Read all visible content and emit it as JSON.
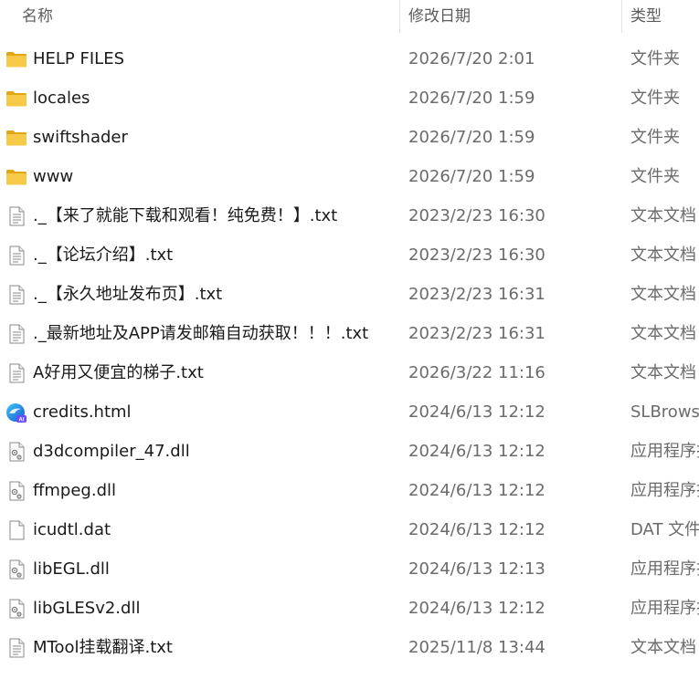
{
  "header": {
    "name_label": "名称",
    "date_label": "修改日期",
    "type_label": "类型",
    "sort_indicator": "^"
  },
  "files": [
    {
      "name": "HELP FILES",
      "date": "2026/7/20 2:01",
      "type": "文件夹",
      "icon": "folder-icon"
    },
    {
      "name": "locales",
      "date": "2026/7/20 1:59",
      "type": "文件夹",
      "icon": "folder-icon"
    },
    {
      "name": "swiftshader",
      "date": "2026/7/20 1:59",
      "type": "文件夹",
      "icon": "folder-icon"
    },
    {
      "name": "www",
      "date": "2026/7/20 1:59",
      "type": "文件夹",
      "icon": "folder-icon"
    },
    {
      "name": "._【来了就能下载和观看！纯免费！】.txt",
      "date": "2023/2/23 16:30",
      "type": "文本文档",
      "icon": "text-file-icon"
    },
    {
      "name": "._【论坛介绍】.txt",
      "date": "2023/2/23 16:30",
      "type": "文本文档",
      "icon": "text-file-icon"
    },
    {
      "name": "._【永久地址发布页】.txt",
      "date": "2023/2/23 16:31",
      "type": "文本文档",
      "icon": "text-file-icon"
    },
    {
      "name": "._最新地址及APP请发邮箱自动获取！！！.txt",
      "date": "2023/2/23 16:31",
      "type": "文本文档",
      "icon": "text-file-icon"
    },
    {
      "name": "A好用又便宜的梯子.txt",
      "date": "2026/3/22 11:16",
      "type": "文本文档",
      "icon": "text-file-icon"
    },
    {
      "name": "credits.html",
      "date": "2024/6/13 12:12",
      "type": "SLBrowse",
      "icon": "browser-icon"
    },
    {
      "name": "d3dcompiler_47.dll",
      "date": "2024/6/13 12:12",
      "type": "应用程序扩",
      "icon": "dll-file-icon"
    },
    {
      "name": "ffmpeg.dll",
      "date": "2024/6/13 12:12",
      "type": "应用程序扩",
      "icon": "dll-file-icon"
    },
    {
      "name": "icudtl.dat",
      "date": "2024/6/13 12:12",
      "type": "DAT 文件",
      "icon": "blank-file-icon"
    },
    {
      "name": "libEGL.dll",
      "date": "2024/6/13 12:13",
      "type": "应用程序扩",
      "icon": "dll-file-icon"
    },
    {
      "name": "libGLESv2.dll",
      "date": "2024/6/13 12:12",
      "type": "应用程序扩",
      "icon": "dll-file-icon"
    },
    {
      "name": "MTool挂载翻译.txt",
      "date": "2025/11/8 13:44",
      "type": "文本文档",
      "icon": "text-file-icon"
    }
  ],
  "colors": {
    "folder": "#f4c042",
    "folder_dark": "#e2a614",
    "header_text": "#5c5c5c",
    "secondary_text": "#6b6b6b"
  }
}
